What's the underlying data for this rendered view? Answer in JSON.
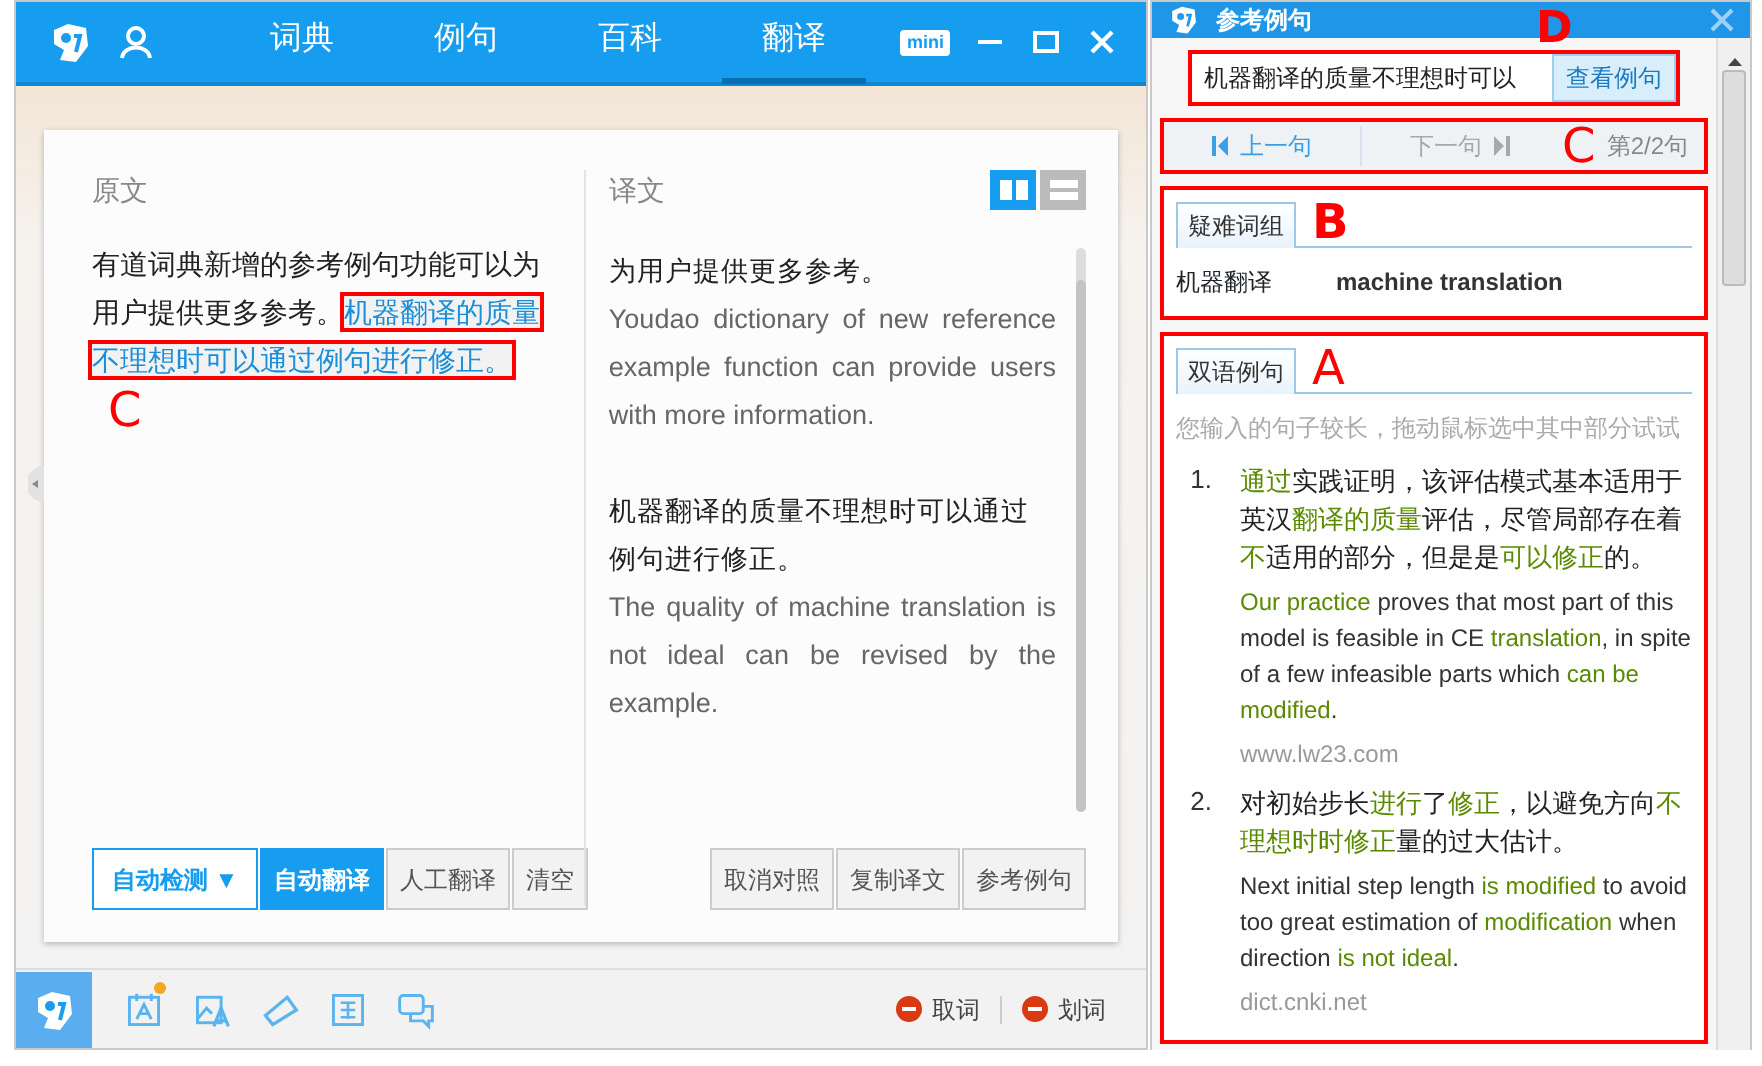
{
  "main_window": {
    "tabs": [
      {
        "label": "词典",
        "selected": false
      },
      {
        "label": "例句",
        "selected": false
      },
      {
        "label": "百科",
        "selected": false
      },
      {
        "label": "翻译",
        "selected": true
      }
    ],
    "mini_label": "mini",
    "source": {
      "heading": "原文",
      "annotation": "C",
      "segments": [
        {
          "text": "有道词典新增的参考例句功能可以为用户提供更多参考。",
          "selected": false
        },
        {
          "text": "机器翻译的质量不理想时可以通过例句进行修正。",
          "selected": true
        }
      ]
    },
    "target": {
      "heading": "译文",
      "layout_modes": [
        {
          "kind": "columns",
          "selected": true
        },
        {
          "kind": "rows",
          "selected": false
        }
      ],
      "paragraphs": [
        {
          "zh": "为用户提供更多参考。",
          "en": "Youdao dictionary of new reference example function can provide users with more information."
        },
        {
          "zh": "机器翻译的质量不理想时可以通过例句进行修正。",
          "en": "The quality of machine translation is not ideal can be revised by the example."
        }
      ]
    },
    "source_buttons": [
      {
        "label": "自动检测 ▼",
        "kind": "dropdown",
        "selected": false
      },
      {
        "label": "自动翻译",
        "kind": "mode",
        "selected": true
      },
      {
        "label": "人工翻译",
        "kind": "mode",
        "selected": false
      },
      {
        "label": "清空",
        "kind": "action",
        "selected": false
      }
    ],
    "target_buttons": [
      "取消对照",
      "复制译文",
      "参考例句"
    ],
    "tools": [
      {
        "kind": "logo",
        "selected": true,
        "badge": false
      },
      {
        "kind": "calendar",
        "selected": false,
        "badge": true
      },
      {
        "kind": "picture",
        "selected": false,
        "badge": false
      },
      {
        "kind": "pen",
        "selected": false,
        "badge": false
      },
      {
        "kind": "translate",
        "selected": false,
        "badge": false
      },
      {
        "kind": "chat",
        "selected": false,
        "badge": false
      }
    ],
    "toggles": [
      {
        "label": "取词",
        "on": false
      },
      {
        "label": "划词",
        "on": false
      }
    ]
  },
  "reference_window": {
    "title": "参考例句",
    "query": "机器翻译的质量不理想时可以",
    "search_button": "查看例句",
    "annotation": "D",
    "nav": {
      "annotation": "C",
      "prev": {
        "label": "上一句",
        "disabled": false
      },
      "next": {
        "label": "下一句",
        "disabled": true
      },
      "position": "第2/2句"
    },
    "phrases": {
      "tab": "疑难词组",
      "annotation": "B",
      "items": [
        {
          "zh": "机器翻译",
          "en": "machine translation"
        }
      ]
    },
    "examples": {
      "tab": "双语例句",
      "annotation": "A",
      "hint": "您输入的句子较长，拖动鼠标选中其中部分试试",
      "items": [
        {
          "number": "1.",
          "zh": [
            {
              "text": "通过",
              "highlight": true
            },
            {
              "text": "实践证明，该评估模式基本适用于英汉",
              "highlight": false
            },
            {
              "text": "翻译的质量",
              "highlight": true
            },
            {
              "text": "评估，尽管局部存在着",
              "highlight": false
            },
            {
              "text": "不",
              "highlight": true
            },
            {
              "text": "适用的部分，但是是",
              "highlight": false
            },
            {
              "text": "可以修正",
              "highlight": true
            },
            {
              "text": "的。",
              "highlight": false
            }
          ],
          "en": [
            {
              "text": "Our practice",
              "highlight": true
            },
            {
              "text": " proves that most part of this model is feasible in CE ",
              "highlight": false
            },
            {
              "text": "translation",
              "highlight": true
            },
            {
              "text": ", in spite of a few infeasible parts which ",
              "highlight": false
            },
            {
              "text": "can be modified",
              "highlight": true
            },
            {
              "text": ".",
              "highlight": false
            }
          ],
          "source": "www.lw23.com"
        },
        {
          "number": "2.",
          "zh": [
            {
              "text": "对初始步长",
              "highlight": false
            },
            {
              "text": "进行",
              "highlight": true
            },
            {
              "text": "了",
              "highlight": false
            },
            {
              "text": "修正",
              "highlight": true
            },
            {
              "text": "，以避免方向",
              "highlight": false
            },
            {
              "text": "不理想时时修正",
              "highlight": true
            },
            {
              "text": "量的过大估计。",
              "highlight": false
            }
          ],
          "en": [
            {
              "text": "Next initial step length ",
              "highlight": false
            },
            {
              "text": "is modified",
              "highlight": true
            },
            {
              "text": " to avoid too great estimation of ",
              "highlight": false
            },
            {
              "text": "modification",
              "highlight": true
            },
            {
              "text": " when direction ",
              "highlight": false
            },
            {
              "text": "is not ideal",
              "highlight": true
            },
            {
              "text": ".",
              "highlight": false
            }
          ],
          "source": "dict.cnki.net"
        }
      ]
    }
  }
}
